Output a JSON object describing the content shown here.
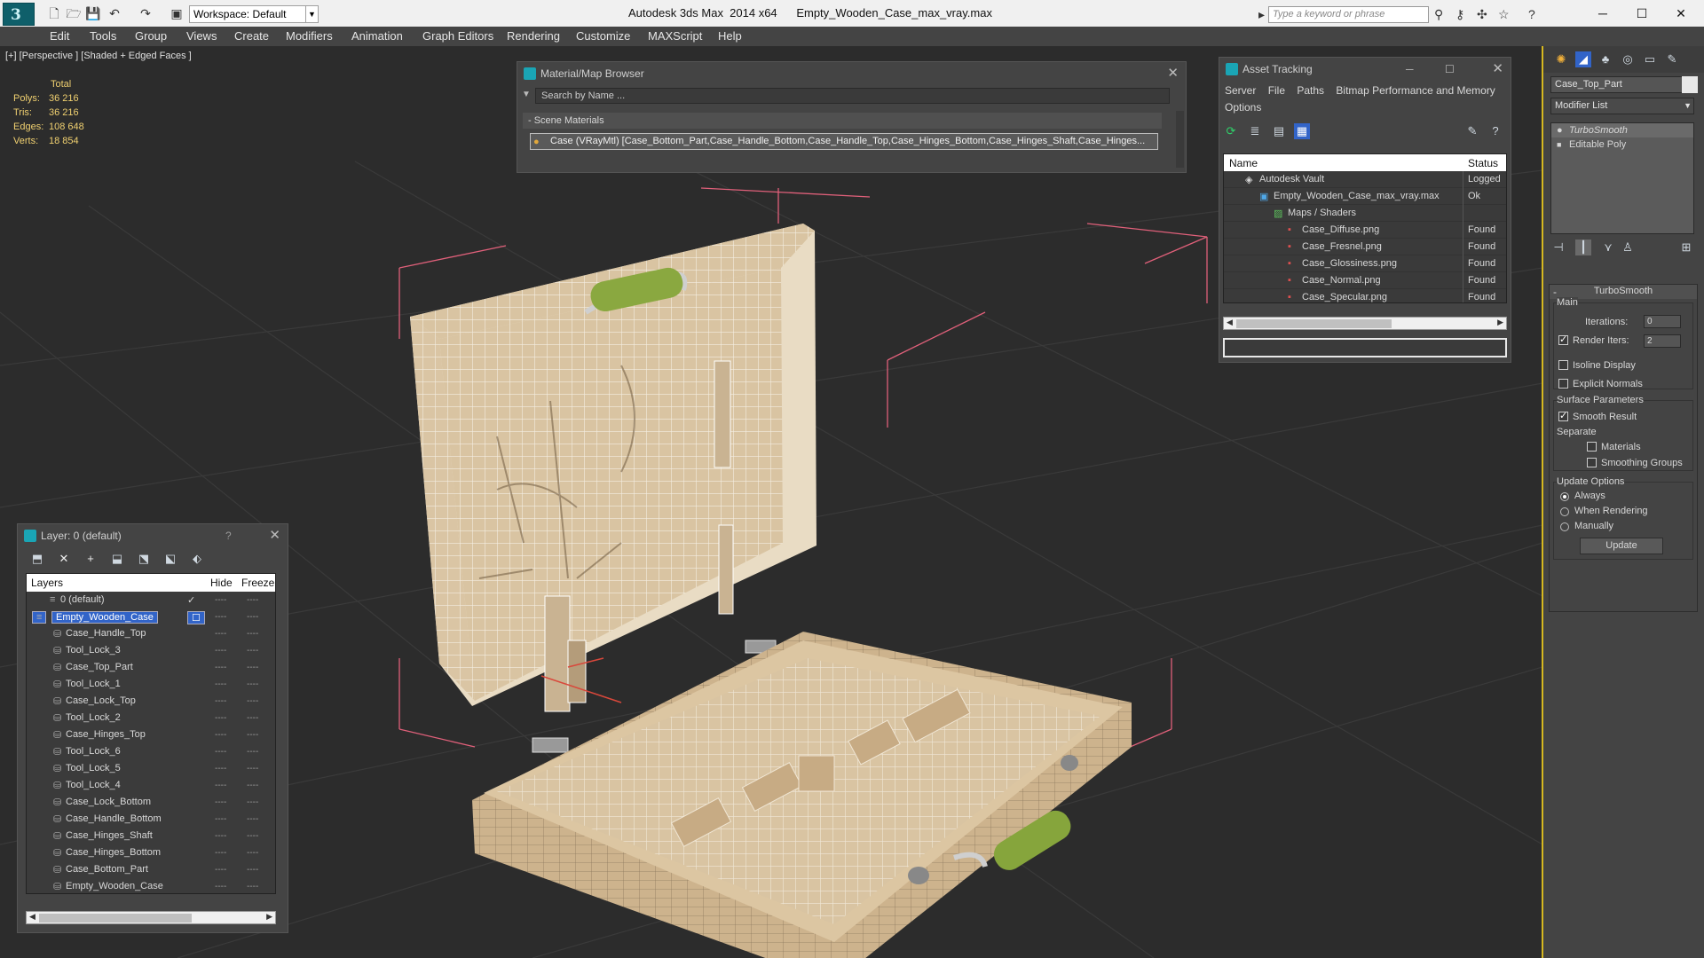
{
  "titlebar": {
    "workspace": "Workspace: Default",
    "app_title": "Autodesk 3ds Max  2014 x64      Empty_Wooden_Case_max_vray.max",
    "search_placeholder": "Type a keyword or phrase"
  },
  "menu": [
    "Edit",
    "Tools",
    "Group",
    "Views",
    "Create",
    "Modifiers",
    "Animation",
    "Graph Editors",
    "Rendering",
    "Customize",
    "MAXScript",
    "Help"
  ],
  "viewport": {
    "label": "[+] [Perspective ] [Shaded + Edged Faces ]",
    "stats": {
      "header": "Total",
      "polys_label": "Polys:",
      "polys": "36 216",
      "tris_label": "Tris:",
      "tris": "36 216",
      "edges_label": "Edges:",
      "edges": "108 648",
      "verts_label": "Verts:",
      "verts": "18 854"
    }
  },
  "material_browser": {
    "title": "Material/Map Browser",
    "search": "Search by Name ...",
    "group": "- Scene Materials",
    "item": "Case (VRayMtl) [Case_Bottom_Part,Case_Handle_Bottom,Case_Handle_Top,Case_Hinges_Bottom,Case_Hinges_Shaft,Case_Hinges..."
  },
  "asset_tracking": {
    "title": "Asset Tracking",
    "menu": [
      "Server",
      "File",
      "Paths",
      "Bitmap Performance and Memory",
      "Options"
    ],
    "col_name": "Name",
    "col_status": "Status",
    "rows": [
      {
        "name": "Autodesk Vault",
        "status": "Logged"
      },
      {
        "name": "Empty_Wooden_Case_max_vray.max",
        "status": "Ok"
      },
      {
        "name": "Maps / Shaders",
        "status": ""
      },
      {
        "name": "Case_Diffuse.png",
        "status": "Found"
      },
      {
        "name": "Case_Fresnel.png",
        "status": "Found"
      },
      {
        "name": "Case_Glossiness.png",
        "status": "Found"
      },
      {
        "name": "Case_Normal.png",
        "status": "Found"
      },
      {
        "name": "Case_Specular.png",
        "status": "Found"
      }
    ]
  },
  "layers": {
    "title": "Layer: 0 (default)",
    "help": "?",
    "col_layers": "Layers",
    "col_hide": "Hide",
    "col_freeze": "Freeze",
    "rows": [
      "0 (default)",
      "Empty_Wooden_Case",
      "Case_Handle_Top",
      "Tool_Lock_3",
      "Case_Top_Part",
      "Tool_Lock_1",
      "Case_Lock_Top",
      "Tool_Lock_2",
      "Case_Hinges_Top",
      "Tool_Lock_6",
      "Tool_Lock_5",
      "Tool_Lock_4",
      "Case_Lock_Bottom",
      "Case_Handle_Bottom",
      "Case_Hinges_Shaft",
      "Case_Hinges_Bottom",
      "Case_Bottom_Part",
      "Empty_Wooden_Case"
    ]
  },
  "command_panel": {
    "object_name": "Case_Top_Part",
    "modifier_list": "Modifier List",
    "stack": [
      "TurboSmooth",
      "Editable Poly"
    ],
    "rollout": "TurboSmooth",
    "main": "Main",
    "iterations_label": "Iterations:",
    "iterations": "0",
    "render_iters_label": "Render Iters:",
    "render_iters": "2",
    "isoline": "Isoline Display",
    "explicit": "Explicit Normals",
    "surface": "Surface Parameters",
    "smooth_result": "Smooth Result",
    "separate": "Separate",
    "materials": "Materials",
    "smoothing_groups": "Smoothing Groups",
    "update_options": "Update Options",
    "always": "Always",
    "when_rendering": "When Rendering",
    "manually": "Manually",
    "update": "Update"
  },
  "colors": {
    "accent": "#1aa5b5",
    "selection": "#3264c8",
    "stats": "#f0d070",
    "viewport_border": "#d6b820"
  }
}
